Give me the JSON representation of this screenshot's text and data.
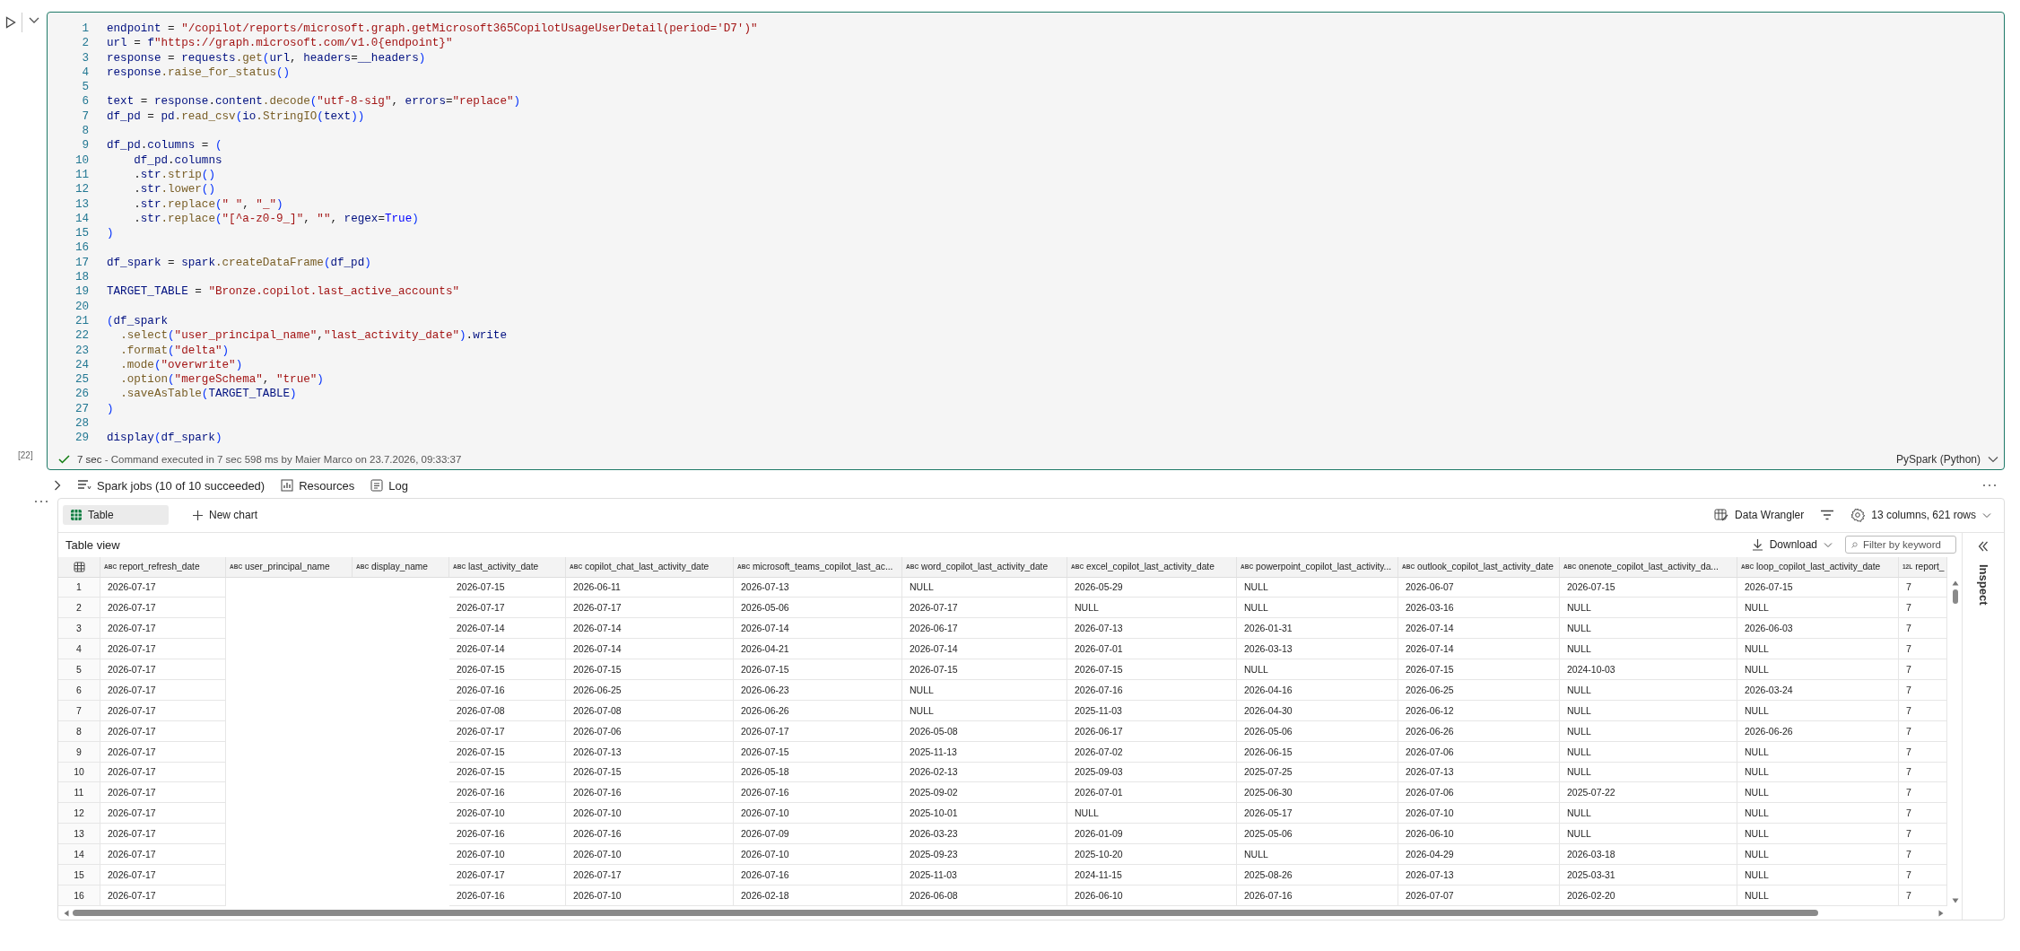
{
  "cell": {
    "exec_count": "[22]",
    "lines": [
      {
        "n": "1",
        "code": "endpoint = \"/copilot/reports/microsoft.graph.getMicrosoft365CopilotUsageUserDetail(period='D7')\""
      },
      {
        "n": "2",
        "code": "url = f\"https://graph.microsoft.com/v1.0{endpoint}\""
      },
      {
        "n": "3",
        "code": "response = requests.get(url, headers=__headers)"
      },
      {
        "n": "4",
        "code": "response.raise_for_status()"
      },
      {
        "n": "5"
      },
      {
        "n": "6",
        "code": "text = response.content.decode(\"utf-8-sig\", errors=\"replace\")"
      },
      {
        "n": "7",
        "code": "df_pd = pd.read_csv(io.StringIO(text))"
      },
      {
        "n": "8"
      },
      {
        "n": "9",
        "code": "df_pd.columns = ("
      },
      {
        "n": "10",
        "code": "    df_pd.columns"
      },
      {
        "n": "11",
        "code": "    .str.strip()"
      },
      {
        "n": "12",
        "code": "    .str.lower()"
      },
      {
        "n": "13",
        "code": "    .str.replace(\" \", \"_\")"
      },
      {
        "n": "14",
        "code": "    .str.replace(\"[^a-z0-9_]\", \"\", regex=True)"
      },
      {
        "n": "15",
        "code": ")"
      },
      {
        "n": "16"
      },
      {
        "n": "17",
        "code": "df_spark = spark.createDataFrame(df_pd)"
      },
      {
        "n": "18"
      },
      {
        "n": "19",
        "code": "TARGET_TABLE = \"Bronze.copilot.last_active_accounts\""
      },
      {
        "n": "20"
      },
      {
        "n": "21",
        "code": "(df_spark"
      },
      {
        "n": "22",
        "code": "  .select(\"user_principal_name\",\"last_activity_date\").write"
      },
      {
        "n": "23",
        "code": "  .format(\"delta\")"
      },
      {
        "n": "24",
        "code": "  .mode(\"overwrite\")"
      },
      {
        "n": "25",
        "code": "  .option(\"mergeSchema\", \"true\")"
      },
      {
        "n": "26",
        "code": "  .saveAsTable(TARGET_TABLE)"
      },
      {
        "n": "27",
        "code": ")"
      },
      {
        "n": "28"
      },
      {
        "n": "29",
        "code": "display(df_spark)"
      }
    ],
    "status": "**7 sec** - Command executed in 7 sec 598 ms by Maier Marco on 23.7.2026, 09:33:37",
    "language": "PySpark (Python)"
  },
  "output": {
    "links": [
      "Spark jobs (10 of 10 succeeded)",
      "Resources",
      "Log"
    ],
    "tabs": [
      {
        "label": "Table",
        "selected": true
      },
      {
        "label": "New chart",
        "selected": false
      }
    ],
    "data_wrangler": "Data Wrangler",
    "summary": "13 columns, 621 rows",
    "title": "Table view",
    "download": "Download",
    "filter": {
      "placeholder": "Filter by keyword"
    },
    "inspect": "Inspect",
    "table": {
      "columns": [
        {
          "type": "ABC",
          "name": "report_refresh_date",
          "kind": "data"
        },
        {
          "type": "ABC",
          "name": "user_principal_name",
          "kind": "blank"
        },
        {
          "type": "ABC",
          "name": "display_name",
          "kind": "blank"
        },
        {
          "type": "ABC",
          "name": "last_activity_date",
          "kind": "data"
        },
        {
          "type": "ABC",
          "name": "copilot_chat_last_activity_date",
          "kind": "data"
        },
        {
          "type": "ABC",
          "name": "microsoft_teams_copilot_last_ac...",
          "kind": "data"
        },
        {
          "type": "ABC",
          "name": "word_copilot_last_activity_date",
          "kind": "data"
        },
        {
          "type": "ABC",
          "name": "excel_copilot_last_activity_date",
          "kind": "data"
        },
        {
          "type": "ABC",
          "name": "powerpoint_copilot_last_activity...",
          "kind": "data"
        },
        {
          "type": "ABC",
          "name": "outlook_copilot_last_activity_date",
          "kind": "data"
        },
        {
          "type": "ABC",
          "name": "onenote_copilot_last_activity_da...",
          "kind": "data"
        },
        {
          "type": "ABC",
          "name": "loop_copilot_last_activity_date",
          "kind": "data"
        },
        {
          "type": "12L",
          "name": "report_",
          "kind": "data"
        }
      ],
      "rows": [
        {
          "n": "1",
          "values": [
            "2026-07-17",
            "2026-07-15",
            "2026-06-11",
            "2026-07-13",
            "NULL",
            "2026-05-29",
            "NULL",
            "2026-06-07",
            "2026-07-15",
            "2026-07-15",
            "7"
          ]
        },
        {
          "n": "2",
          "values": [
            "2026-07-17",
            "2026-07-17",
            "2026-07-17",
            "2026-05-06",
            "2026-07-17",
            "NULL",
            "NULL",
            "2026-03-16",
            "NULL",
            "NULL",
            "7"
          ]
        },
        {
          "n": "3",
          "values": [
            "2026-07-17",
            "2026-07-14",
            "2026-07-14",
            "2026-07-14",
            "2026-06-17",
            "2026-07-13",
            "2026-01-31",
            "2026-07-14",
            "NULL",
            "2026-06-03",
            "7"
          ]
        },
        {
          "n": "4",
          "values": [
            "2026-07-17",
            "2026-07-14",
            "2026-07-14",
            "2026-04-21",
            "2026-07-14",
            "2026-07-01",
            "2026-03-13",
            "2026-07-14",
            "NULL",
            "NULL",
            "7"
          ]
        },
        {
          "n": "5",
          "values": [
            "2026-07-17",
            "2026-07-15",
            "2026-07-15",
            "2026-07-15",
            "2026-07-15",
            "2026-07-15",
            "NULL",
            "2026-07-15",
            "2024-10-03",
            "NULL",
            "7"
          ]
        },
        {
          "n": "6",
          "values": [
            "2026-07-17",
            "2026-07-16",
            "2026-06-25",
            "2026-06-23",
            "NULL",
            "2026-07-16",
            "2026-04-16",
            "2026-06-25",
            "NULL",
            "2026-03-24",
            "7"
          ]
        },
        {
          "n": "7",
          "values": [
            "2026-07-17",
            "2026-07-08",
            "2026-07-08",
            "2026-06-26",
            "NULL",
            "2025-11-03",
            "2026-04-30",
            "2026-06-12",
            "NULL",
            "NULL",
            "7"
          ]
        },
        {
          "n": "8",
          "values": [
            "2026-07-17",
            "2026-07-17",
            "2026-07-06",
            "2026-07-17",
            "2026-05-08",
            "2026-06-17",
            "2026-05-06",
            "2026-06-26",
            "NULL",
            "2026-06-26",
            "7"
          ]
        },
        {
          "n": "9",
          "values": [
            "2026-07-17",
            "2026-07-15",
            "2026-07-13",
            "2026-07-15",
            "2025-11-13",
            "2026-07-02",
            "2026-06-15",
            "2026-07-06",
            "NULL",
            "NULL",
            "7"
          ]
        },
        {
          "n": "10",
          "values": [
            "2026-07-17",
            "2026-07-15",
            "2026-07-15",
            "2026-05-18",
            "2026-02-13",
            "2025-09-03",
            "2025-07-25",
            "2026-07-13",
            "NULL",
            "NULL",
            "7"
          ]
        },
        {
          "n": "11",
          "values": [
            "2026-07-17",
            "2026-07-16",
            "2026-07-16",
            "2026-07-16",
            "2025-09-02",
            "2026-07-01",
            "2025-06-30",
            "2026-07-06",
            "2025-07-22",
            "NULL",
            "7"
          ]
        },
        {
          "n": "12",
          "values": [
            "2026-07-17",
            "2026-07-10",
            "2026-07-10",
            "2026-07-10",
            "2025-10-01",
            "NULL",
            "2026-05-17",
            "2026-07-10",
            "NULL",
            "NULL",
            "7"
          ]
        },
        {
          "n": "13",
          "values": [
            "2026-07-17",
            "2026-07-16",
            "2026-07-16",
            "2026-07-09",
            "2026-03-23",
            "2026-01-09",
            "2025-05-06",
            "2026-06-10",
            "NULL",
            "NULL",
            "7"
          ]
        },
        {
          "n": "14",
          "values": [
            "2026-07-17",
            "2026-07-10",
            "2026-07-10",
            "2026-07-10",
            "2025-09-23",
            "2025-10-20",
            "NULL",
            "2026-04-29",
            "2026-03-18",
            "NULL",
            "7"
          ]
        },
        {
          "n": "15",
          "values": [
            "2026-07-17",
            "2026-07-17",
            "2026-07-17",
            "2026-07-16",
            "2025-11-03",
            "2024-11-15",
            "2025-08-26",
            "2026-07-13",
            "2025-03-31",
            "NULL",
            "7"
          ]
        },
        {
          "n": "16",
          "values": [
            "2026-07-17",
            "2026-07-16",
            "2026-07-10",
            "2026-02-18",
            "2026-06-08",
            "2026-06-10",
            "2026-07-16",
            "2026-07-07",
            "2026-02-20",
            "NULL",
            "7"
          ]
        }
      ]
    }
  }
}
